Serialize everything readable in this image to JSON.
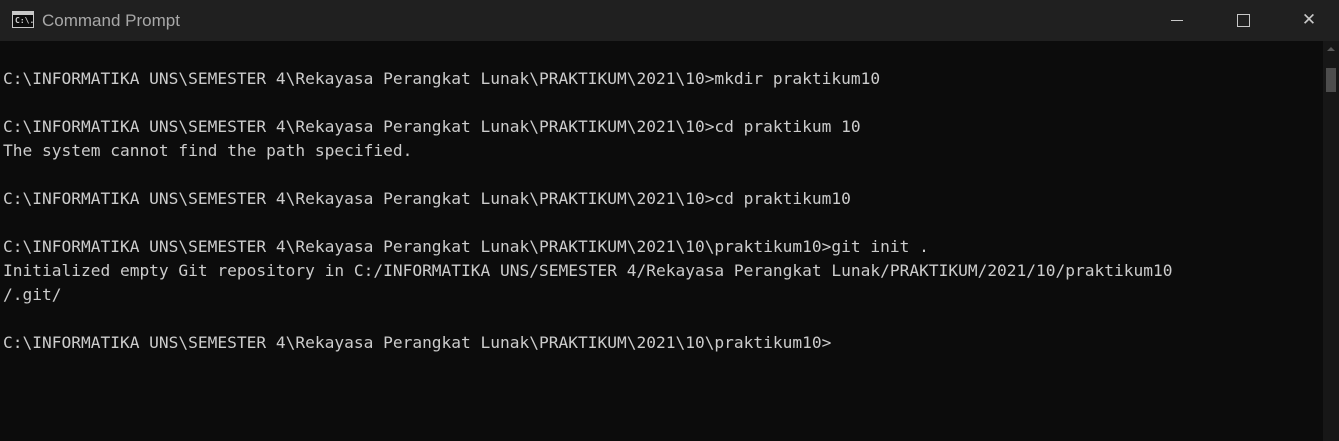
{
  "window": {
    "title": "Command Prompt",
    "icon_label": "C:\\.",
    "controls": {
      "minimize": "minimize-icon",
      "maximize": "maximize-icon",
      "close": "close-icon",
      "close_glyph": "✕"
    }
  },
  "console": {
    "lines": [
      "C:\\INFORMATIKA UNS\\SEMESTER 4\\Rekayasa Perangkat Lunak\\PRAKTIKUM\\2021\\10>mkdir praktikum10",
      "",
      "C:\\INFORMATIKA UNS\\SEMESTER 4\\Rekayasa Perangkat Lunak\\PRAKTIKUM\\2021\\10>cd praktikum 10",
      "The system cannot find the path specified.",
      "",
      "C:\\INFORMATIKA UNS\\SEMESTER 4\\Rekayasa Perangkat Lunak\\PRAKTIKUM\\2021\\10>cd praktikum10",
      "",
      "C:\\INFORMATIKA UNS\\SEMESTER 4\\Rekayasa Perangkat Lunak\\PRAKTIKUM\\2021\\10\\praktikum10>git init .",
      "Initialized empty Git repository in C:/INFORMATIKA UNS/SEMESTER 4/Rekayasa Perangkat Lunak/PRAKTIKUM/2021/10/praktikum10",
      "/.git/",
      "",
      "C:\\INFORMATIKA UNS\\SEMESTER 4\\Rekayasa Perangkat Lunak\\PRAKTIKUM\\2021\\10\\praktikum10>"
    ]
  },
  "colors": {
    "console_background": "#0c0c0c",
    "console_text": "#cccccc",
    "titlebar_background": "#202020",
    "title_text": "#a8a8a8"
  }
}
